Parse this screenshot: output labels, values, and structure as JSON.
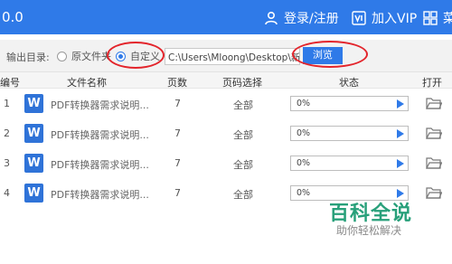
{
  "topbar": {
    "version": "0.0",
    "login_label": "登录/注册",
    "vip_label": "加入VIP",
    "more_label": "菜"
  },
  "output": {
    "label": "输出目录:",
    "option_source": "原文件夹",
    "option_custom": "自定义",
    "path_value": "C:\\Users\\Mloong\\Desktop\\新建文",
    "browse_label": "浏览"
  },
  "table": {
    "headers": {
      "index": "编号",
      "filename": "文件名称",
      "pages": "页数",
      "page_select": "页码选择",
      "status": "状态",
      "open": "打开"
    },
    "rows": [
      {
        "index": "1",
        "icon": "W",
        "filename": "PDF转换器需求说明...",
        "pages": "7",
        "page_select": "全部",
        "progress": 0,
        "progress_label": "0%"
      },
      {
        "index": "2",
        "icon": "W",
        "filename": "PDF转换器需求说明...",
        "pages": "7",
        "page_select": "全部",
        "progress": 0,
        "progress_label": "0%"
      },
      {
        "index": "3",
        "icon": "W",
        "filename": "PDF转换器需求说明...",
        "pages": "7",
        "page_select": "全部",
        "progress": 0,
        "progress_label": "0%"
      },
      {
        "index": "4",
        "icon": "W",
        "filename": "PDF转换器需求说明...",
        "pages": "7",
        "page_select": "全部",
        "progress": 0,
        "progress_label": "0%"
      }
    ]
  },
  "watermark": {
    "title": "百科全说",
    "subtitle": "助你轻松解决"
  },
  "colors": {
    "accent": "#2f7ae8",
    "highlight_ring": "#e3242b",
    "watermark_green": "#28a07a"
  }
}
